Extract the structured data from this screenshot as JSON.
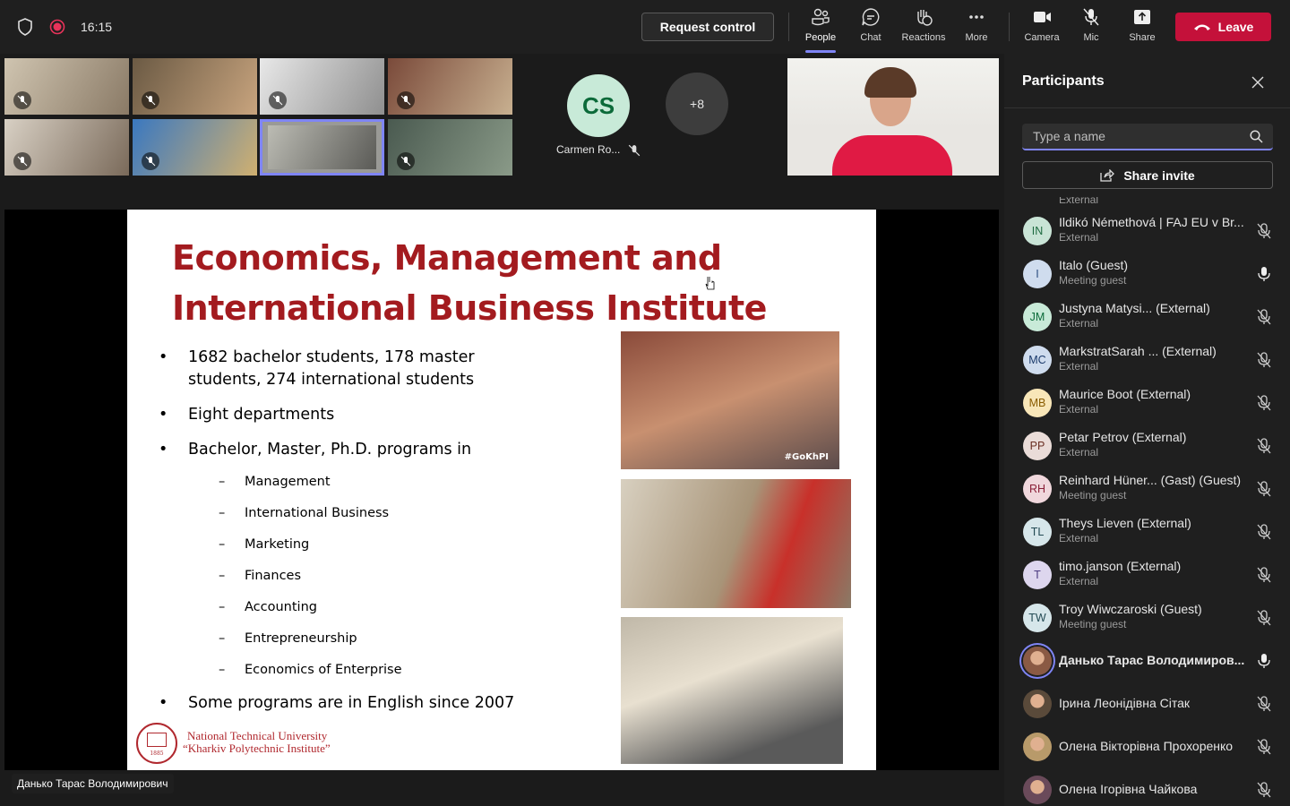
{
  "topbar": {
    "time": "16:15",
    "request_control": "Request control",
    "buttons": [
      {
        "label": "People"
      },
      {
        "label": "Chat"
      },
      {
        "label": "Reactions"
      },
      {
        "label": "More"
      },
      {
        "label": "Camera"
      },
      {
        "label": "Mic"
      },
      {
        "label": "Share"
      }
    ],
    "leave": "Leave",
    "accent": "#7f85f5",
    "leave_color": "#c4113a"
  },
  "gallery": {
    "avatar_initials": "CS",
    "avatar_name": "Carmen Ro...",
    "overflow": "+8"
  },
  "stage": {
    "presenter_label": "Данько Тарас Володимирович"
  },
  "slide": {
    "title_line1": "Economics, Management and",
    "title_line2": "International Business Institute",
    "bullets": [
      "1682 bachelor students, 178 master students, 274 international students",
      "Eight departments",
      "Bachelor, Master, Ph.D. programs in",
      "Some programs are in English since 2007"
    ],
    "programs": [
      "Management",
      "International Business",
      "Marketing",
      "Finances",
      "Accounting",
      "Entrepreneurship",
      "Economics of Enterprise"
    ],
    "logo_line1": "National Technical University",
    "logo_line2": "“Kharkiv Polytechnic Institute”",
    "logo_year": "1885",
    "photo_tag": "#GoKhPI"
  },
  "panel": {
    "title": "Participants",
    "search_placeholder": "Type a name",
    "share_invite": "Share invite",
    "partial_top": "External",
    "participants": [
      {
        "initials": "IN",
        "name": "Ildikó Némethová | FAJ EU v Br...",
        "sub": "External",
        "mic": "muted",
        "bg": "#c9e4d6",
        "fg": "#1e6b41"
      },
      {
        "initials": "I",
        "name": "Italo (Guest)",
        "sub": "Meeting guest",
        "mic": "on",
        "bg": "#cfdcee",
        "fg": "#2b4d80"
      },
      {
        "initials": "JM",
        "name": "Justyna Matysi...   (External)",
        "sub": "External",
        "mic": "muted",
        "bg": "#c8ead8",
        "fg": "#0b6a39"
      },
      {
        "initials": "MC",
        "name": "MarkstratSarah ... (External)",
        "sub": "External",
        "mic": "muted",
        "bg": "#cfdcee",
        "fg": "#1b3a6b"
      },
      {
        "initials": "MB",
        "name": "Maurice Boot (External)",
        "sub": "External",
        "mic": "muted",
        "bg": "#f8e6b8",
        "fg": "#8a5c00"
      },
      {
        "initials": "PP",
        "name": "Petar Petrov (External)",
        "sub": "External",
        "mic": "muted",
        "bg": "#eadcd8",
        "fg": "#6b2f22"
      },
      {
        "initials": "RH",
        "name": "Reinhard Hüner...  (Gast) (Guest)",
        "sub": "Meeting guest",
        "mic": "muted",
        "bg": "#f0d7dc",
        "fg": "#8a1f38"
      },
      {
        "initials": "TL",
        "name": "Theys Lieven (External)",
        "sub": "External",
        "mic": "muted",
        "bg": "#d6e6ea",
        "fg": "#234a54"
      },
      {
        "initials": "T",
        "name": "timo.janson (External)",
        "sub": "External",
        "mic": "muted",
        "bg": "#ddd6ee",
        "fg": "#4b3a80"
      },
      {
        "initials": "TW",
        "name": "Troy Wiwczaroski (Guest)",
        "sub": "Meeting guest",
        "mic": "muted",
        "bg": "#d6e6ea",
        "fg": "#234a54"
      },
      {
        "initials": "",
        "name": "Данько Тарас Володимиров...",
        "sub": "",
        "mic": "on",
        "bg": "#8a5a44",
        "fg": "#fff",
        "photo": true,
        "speaking": true
      },
      {
        "initials": "",
        "name": "Ірина Леонідівна Сітак",
        "sub": "",
        "mic": "muted",
        "bg": "#5a4a3a",
        "fg": "#fff",
        "photo": true
      },
      {
        "initials": "",
        "name": "Олена Вікторівна Прохоренко",
        "sub": "",
        "mic": "muted",
        "bg": "#b89a6a",
        "fg": "#fff",
        "photo": true
      },
      {
        "initials": "",
        "name": "Олена Ігорівна Чайкова",
        "sub": "",
        "mic": "muted",
        "bg": "#6a4a5a",
        "fg": "#fff",
        "photo": true
      }
    ]
  }
}
